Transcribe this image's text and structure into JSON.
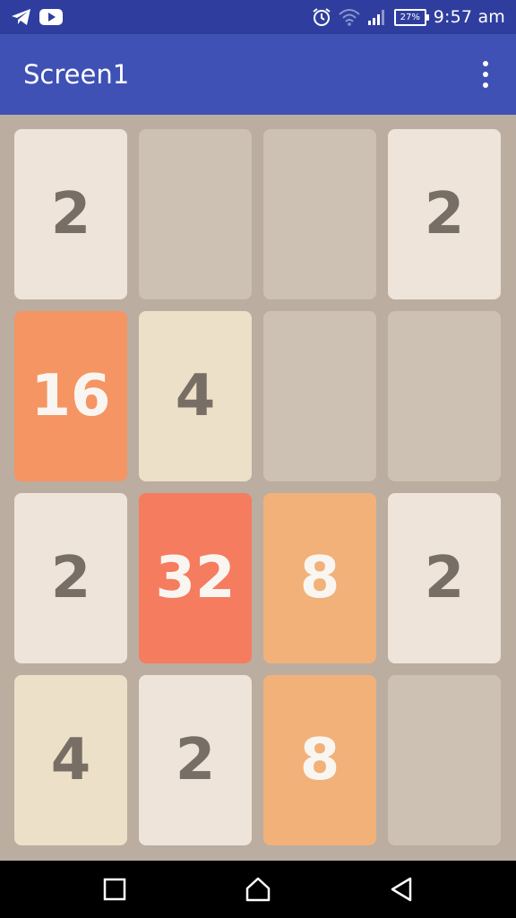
{
  "status_bar": {
    "time": "9:57 am",
    "battery": "27%",
    "icons": [
      "telegram-icon",
      "youtube-icon",
      "alarm-icon",
      "wifi-icon",
      "signal-icon",
      "battery-icon"
    ]
  },
  "app_bar": {
    "title": "Screen1",
    "menu_icon": "overflow-menu-icon"
  },
  "board": {
    "rows": [
      [
        "2",
        "",
        "",
        "2"
      ],
      [
        "16",
        "4",
        "",
        ""
      ],
      [
        "2",
        "32",
        "8",
        "2"
      ],
      [
        "4",
        "2",
        "8",
        ""
      ]
    ]
  },
  "tile_colors": {
    "empty": "#cdc1b4",
    "2": "#eee4da",
    "4": "#ede0c8",
    "8": "#f2b179",
    "16": "#f59563",
    "32": "#f67c5f"
  },
  "text_colors": {
    "dark": "#776e65",
    "light": "#f9f6f2"
  },
  "nav_bar": {
    "buttons": [
      "recents-square-icon",
      "home-icon",
      "back-triangle-icon"
    ]
  }
}
